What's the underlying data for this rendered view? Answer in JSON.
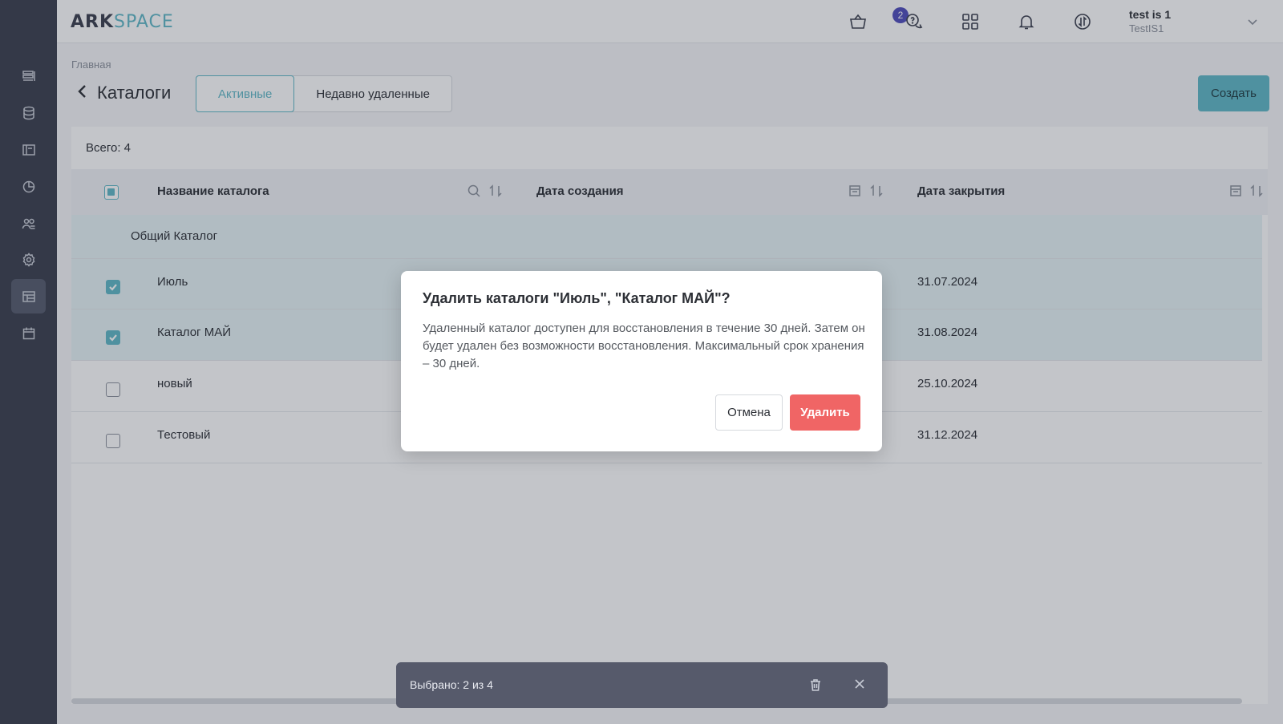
{
  "header": {
    "logo_part1": "ARK",
    "logo_part2": "SPACE",
    "cart_badge": "2",
    "user_name": "test is 1",
    "user_org": "TestIS1"
  },
  "sidebar": {
    "items": [
      {
        "icon": "list-icon"
      },
      {
        "icon": "database-icon"
      },
      {
        "icon": "book-icon"
      },
      {
        "icon": "chart-pie-icon"
      },
      {
        "icon": "users-icon"
      },
      {
        "icon": "gear-icon"
      },
      {
        "icon": "catalog-icon",
        "active": true
      },
      {
        "icon": "calendar-icon"
      }
    ]
  },
  "breadcrumb": "Главная",
  "page": {
    "title": "Каталоги",
    "tabs": [
      "Активные",
      "Недавно удаленные"
    ],
    "create_label": "Создать"
  },
  "table": {
    "total": "Всего: 4",
    "columns": [
      "Название каталога",
      "Дата создания",
      "Дата закрытия"
    ],
    "group_row": "Общий Каталог",
    "rows": [
      {
        "name": "Июль",
        "closed": "31.07.2024",
        "checked": true
      },
      {
        "name": "Каталог МАЙ",
        "closed": "31.08.2024",
        "checked": true
      },
      {
        "name": "новый",
        "closed": "25.10.2024",
        "checked": false
      },
      {
        "name": "Тестовый",
        "closed": "31.12.2024",
        "checked": false
      }
    ]
  },
  "modal": {
    "title": "Удалить каталоги \"Июль\", \"Каталог МАЙ\"?",
    "text": "Удаленный каталог доступен для восстановления в течение 30 дней. Затем он будет удален без возможности восстановления. Максимальный срок хранения – 30 дней.",
    "cancel_label": "Отмена",
    "delete_label": "Удалить"
  },
  "selection_bar": {
    "text": "Выбрано: 2 из 4"
  },
  "colors": {
    "accent": "#5fb7c6",
    "danger": "#f06565",
    "sidebar": "#3a3e4d",
    "badge": "#4e4bbb"
  }
}
